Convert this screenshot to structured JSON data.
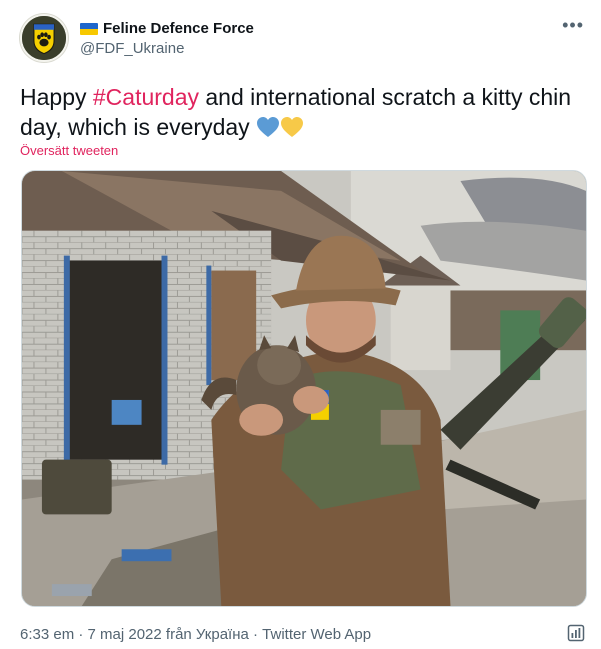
{
  "account": {
    "display_name": "Feline Defence Force",
    "handle": "@FDF_Ukraine",
    "avatar_icon": "paw-shield-icon",
    "flag_icon": "ukraine-flag-icon"
  },
  "menu": {
    "more_label": "•••"
  },
  "tweet": {
    "text_before": "Happy ",
    "hashtag": "#Caturday",
    "text_after": " and international scratch a kitty chin day, which is everyday",
    "emoji": [
      "blue-heart-icon",
      "yellow-heart-icon"
    ],
    "translate_label": "Översätt tweeten"
  },
  "media": {
    "type": "photo",
    "icon": "photo-icon"
  },
  "footer": {
    "meta": "6:33 em · 7 maj 2022 från Україна · Twitter Web App",
    "analytics_icon": "analytics-icon"
  },
  "colors": {
    "hashtag": "#e0245e",
    "secondary_text": "#536471",
    "blue_heart": "#5b9bd5",
    "yellow_heart": "#f7c948"
  }
}
